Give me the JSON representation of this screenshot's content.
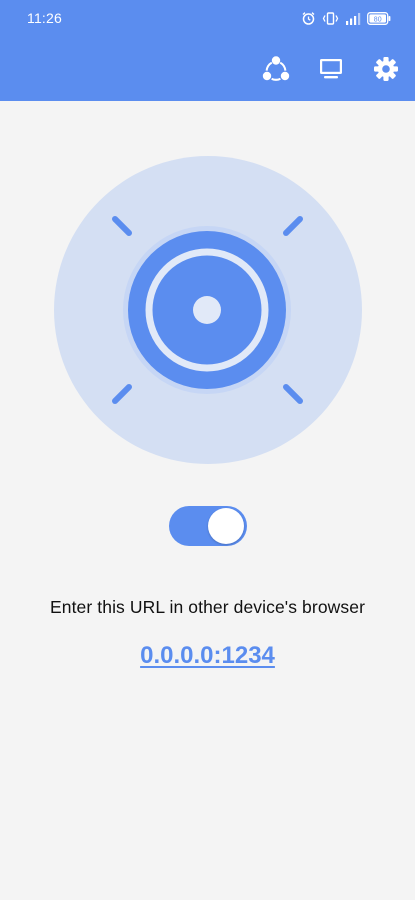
{
  "status_bar": {
    "time": "11:26",
    "icons": [
      "alarm-icon",
      "vibrate-icon",
      "signal-icon",
      "battery-icon"
    ],
    "battery_level": "80"
  },
  "toolbar": {
    "icons": [
      "share-icon",
      "monitor-icon",
      "settings-icon"
    ]
  },
  "server": {
    "toggle_on": true,
    "instruction": "Enter this URL in other device's browser",
    "url": "0.0.0.0:1234"
  },
  "colors": {
    "accent": "#5b8def",
    "hero_bg": "#d4dff3",
    "hero_ring": "#c6d6f5",
    "background": "#f4f4f4"
  }
}
